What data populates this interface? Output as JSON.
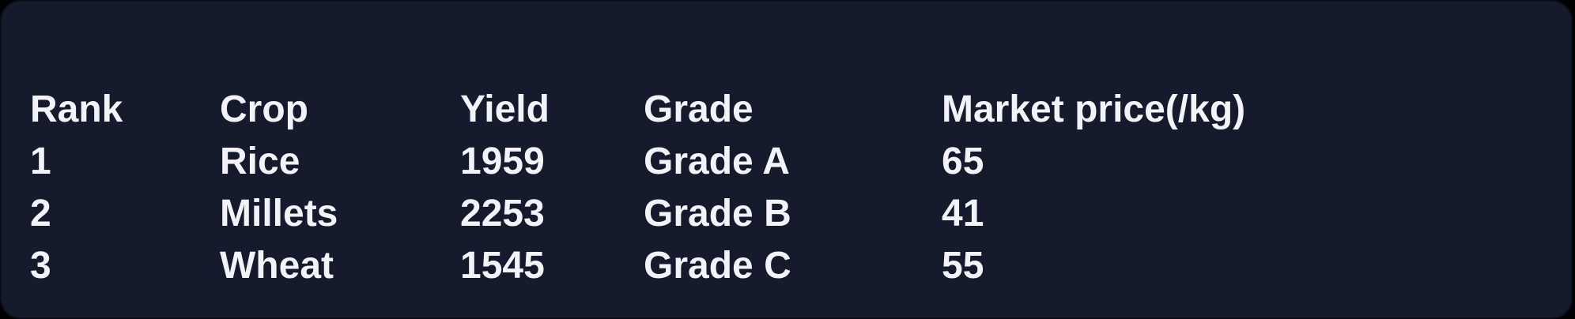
{
  "table": {
    "headers": [
      "Rank",
      "Crop",
      "Yield",
      "Grade",
      "Market price(/kg)"
    ],
    "rows": [
      [
        "1",
        "Rice",
        "1959",
        "Grade A",
        "65"
      ],
      [
        "2",
        "Millets",
        "2253",
        "Grade B",
        "41"
      ],
      [
        "3",
        "Wheat",
        "1545",
        "Grade C",
        "55"
      ]
    ]
  },
  "colors": {
    "panel_background": "#151a2c",
    "page_background": "#000000",
    "text": "#f2f3f7"
  }
}
